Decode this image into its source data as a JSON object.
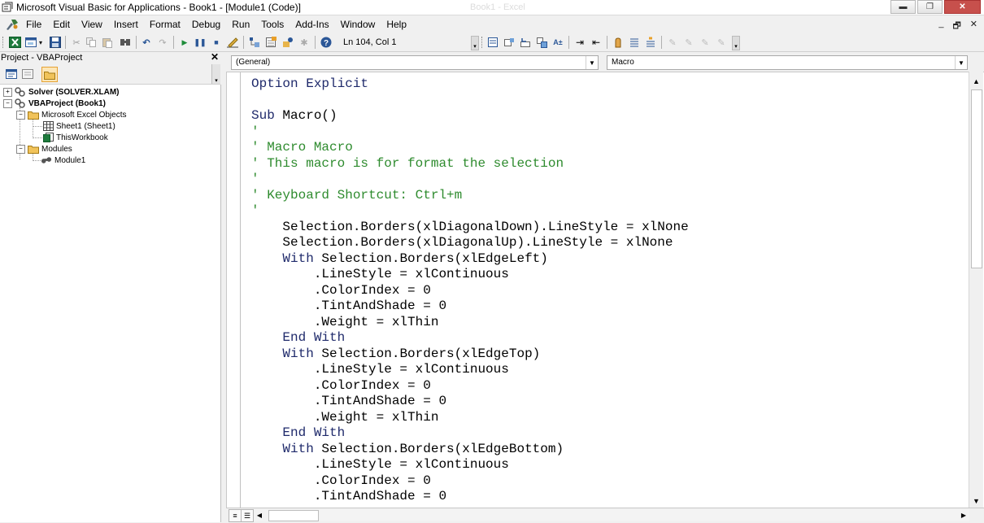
{
  "window": {
    "title": "Microsoft Visual Basic for Applications - Book1 - [Module1 (Code)]",
    "background_title": "Book1 - Excel",
    "minimize_glyph": "▬",
    "restore_glyph": "❐",
    "close_glyph": "✕"
  },
  "menu": {
    "items": [
      "File",
      "Edit",
      "View",
      "Insert",
      "Format",
      "Debug",
      "Run",
      "Tools",
      "Add-Ins",
      "Window",
      "Help"
    ],
    "mdi_controls": [
      "_",
      "🗗",
      "✕"
    ]
  },
  "toolbar": {
    "cursor_position": "Ln 104, Col 1"
  },
  "project_explorer": {
    "title": "Project - VBAProject",
    "close_glyph": "✕",
    "tree": {
      "solver": "Solver (SOLVER.XLAM)",
      "vbaproject": "VBAProject (Book1)",
      "excel_objects": "Microsoft Excel Objects",
      "sheet1": "Sheet1 (Sheet1)",
      "thisworkbook": "ThisWorkbook",
      "modules": "Modules",
      "module1": "Module1"
    }
  },
  "code_header": {
    "object_combo": "(General)",
    "procedure_combo": "Macro"
  },
  "code": {
    "lines": [
      [
        {
          "t": "k",
          "s": "Option Explicit"
        }
      ],
      [],
      [
        {
          "t": "k",
          "s": "Sub "
        },
        {
          "t": "t",
          "s": "Macro()"
        }
      ],
      [
        {
          "t": "c",
          "s": "'"
        }
      ],
      [
        {
          "t": "c",
          "s": "' Macro Macro"
        }
      ],
      [
        {
          "t": "c",
          "s": "' This macro is for format the selection"
        }
      ],
      [
        {
          "t": "c",
          "s": "'"
        }
      ],
      [
        {
          "t": "c",
          "s": "' Keyboard Shortcut: Ctrl+m"
        }
      ],
      [
        {
          "t": "c",
          "s": "'"
        }
      ],
      [
        {
          "t": "t",
          "s": "    Selection.Borders(xlDiagonalDown).LineStyle = xlNone"
        }
      ],
      [
        {
          "t": "t",
          "s": "    Selection.Borders(xlDiagonalUp).LineStyle = xlNone"
        }
      ],
      [
        {
          "t": "k",
          "s": "    With "
        },
        {
          "t": "t",
          "s": "Selection.Borders(xlEdgeLeft)"
        }
      ],
      [
        {
          "t": "t",
          "s": "        .LineStyle = xlContinuous"
        }
      ],
      [
        {
          "t": "t",
          "s": "        .ColorIndex = 0"
        }
      ],
      [
        {
          "t": "t",
          "s": "        .TintAndShade = 0"
        }
      ],
      [
        {
          "t": "t",
          "s": "        .Weight = xlThin"
        }
      ],
      [
        {
          "t": "k",
          "s": "    End With"
        }
      ],
      [
        {
          "t": "k",
          "s": "    With "
        },
        {
          "t": "t",
          "s": "Selection.Borders(xlEdgeTop)"
        }
      ],
      [
        {
          "t": "t",
          "s": "        .LineStyle = xlContinuous"
        }
      ],
      [
        {
          "t": "t",
          "s": "        .ColorIndex = 0"
        }
      ],
      [
        {
          "t": "t",
          "s": "        .TintAndShade = 0"
        }
      ],
      [
        {
          "t": "t",
          "s": "        .Weight = xlThin"
        }
      ],
      [
        {
          "t": "k",
          "s": "    End With"
        }
      ],
      [
        {
          "t": "k",
          "s": "    With "
        },
        {
          "t": "t",
          "s": "Selection.Borders(xlEdgeBottom)"
        }
      ],
      [
        {
          "t": "t",
          "s": "        .LineStyle = xlContinuous"
        }
      ],
      [
        {
          "t": "t",
          "s": "        .ColorIndex = 0"
        }
      ],
      [
        {
          "t": "t",
          "s": "        .TintAndShade = 0"
        }
      ]
    ]
  },
  "colors": {
    "keyword": "#1f2a6b",
    "comment": "#2e8b2e",
    "text": "#000000"
  }
}
